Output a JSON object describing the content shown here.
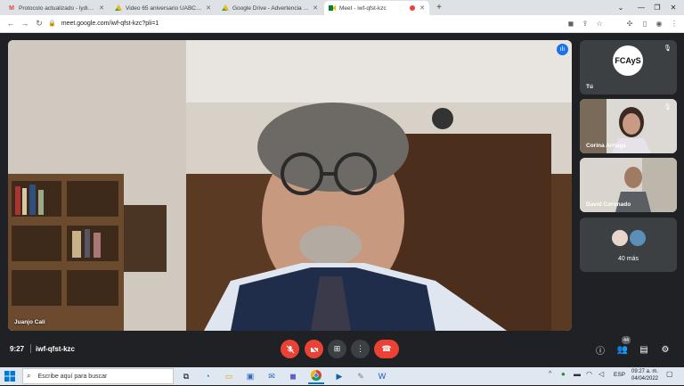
{
  "browser": {
    "tabs": [
      {
        "label": "Protocolo actualizado - lydia.m",
        "icon": "gmail-icon",
        "active": false
      },
      {
        "label": "Video 65 aniversario UABC 24 n",
        "icon": "drive-icon",
        "active": false
      },
      {
        "label": "Google Drive - Advertencia de v",
        "icon": "drive-icon",
        "active": false
      },
      {
        "label": "Meet - iwf-qfst-kzc",
        "icon": "meet-icon",
        "active": true
      }
    ],
    "url": "meet.google.com/iwf-qfst-kzc?pli=1"
  },
  "meet": {
    "main_speaker": "Juanjo Calí",
    "tiles": [
      {
        "name": "Tú",
        "logo_text": "FCAyS"
      },
      {
        "name": "Corina Arriaga"
      },
      {
        "name": "David Coronado"
      },
      {
        "more": "40 más"
      }
    ],
    "time": "9:27",
    "meeting_code": "iwf-qfst-kzc",
    "participants_count": "44"
  },
  "taskbar": {
    "search_placeholder": "Escribe aquí para buscar",
    "language": "ESP",
    "time": "09:27 a. m.",
    "date": "04/04/2022"
  },
  "colors": {
    "end_call": "#ea4335",
    "muted": "#ea4335",
    "accent": "#1a73e8"
  }
}
